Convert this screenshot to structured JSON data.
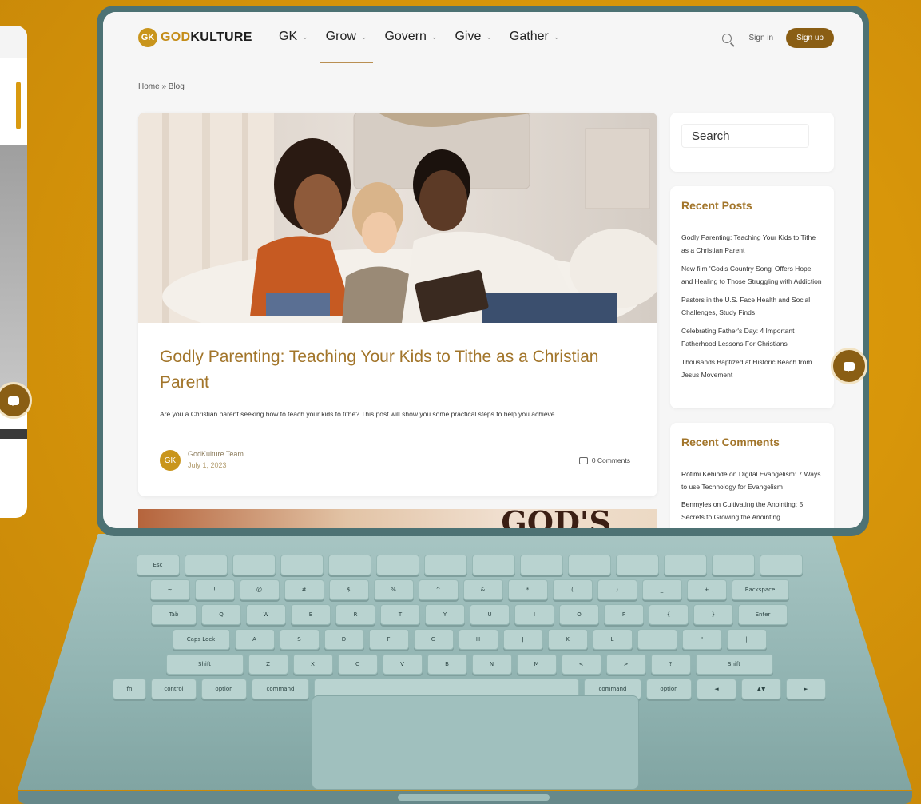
{
  "brand": {
    "logo_mark": "GK",
    "logo_prefix": "GOD",
    "logo_suffix": "KULTURE"
  },
  "nav": {
    "items": [
      {
        "label": "GK",
        "active": false
      },
      {
        "label": "Grow",
        "active": true
      },
      {
        "label": "Govern",
        "active": false
      },
      {
        "label": "Give",
        "active": false
      },
      {
        "label": "Gather",
        "active": false
      }
    ],
    "signin": "Sign in",
    "signup": "Sign up"
  },
  "breadcrumb": "Home » Blog",
  "post": {
    "title": "Godly Parenting: Teaching Your Kids to Tithe as a Christian Parent",
    "excerpt": "Are you a Christian parent seeking how to teach your kids to tithe? This post will show you some practical steps to help you achieve...",
    "author": "GodKulture Team",
    "date": "July 1, 2023",
    "comments": "0 Comments",
    "next_teaser": "GOD'S"
  },
  "sidebar": {
    "search_placeholder": "Search",
    "recent_posts_title": "Recent Posts",
    "recent_posts": [
      "Godly Parenting: Teaching Your Kids to Tithe as a Christian Parent",
      "New film 'God's Country Song' Offers Hope and Healing to Those Struggling with Addiction",
      "Pastors in the U.S. Face Health and Social Challenges, Study Finds",
      "Celebrating Father's Day: 4 Important Fatherhood Lessons For Christians",
      "Thousands Baptized at Historic Beach from Jesus Movement"
    ],
    "recent_comments_title": "Recent Comments",
    "recent_comments": [
      {
        "who": "Rotimi Kehinde",
        "on": "on",
        "post": "Digital Evangelism: 7 Ways to use Technology for Evangelism"
      },
      {
        "who": "Benmyles",
        "on": "on",
        "post": "Cultivating the Anointing: 5 Secrets to Growing the Anointing"
      }
    ]
  },
  "keyboard": {
    "rows": [
      [
        "Esc",
        "",
        "",
        "",
        "",
        "",
        "",
        "",
        "",
        "",
        "",
        "",
        "",
        ""
      ],
      [
        "~",
        "!",
        "@",
        "#",
        "$",
        "%",
        "^",
        "&",
        "*",
        "(",
        ")",
        "_",
        "+",
        "Backspace"
      ],
      [
        "Tab",
        "Q",
        "W",
        "E",
        "R",
        "T",
        "Y",
        "U",
        "I",
        "O",
        "P",
        "{",
        "}",
        "Enter"
      ],
      [
        "Caps Lock",
        "A",
        "S",
        "D",
        "F",
        "G",
        "H",
        "J",
        "K",
        "L",
        ":",
        "\"",
        "|"
      ],
      [
        "Shift",
        "Z",
        "X",
        "C",
        "V",
        "B",
        "N",
        "M",
        "<",
        ">",
        "?",
        "Shift"
      ],
      [
        "fn",
        "control",
        "option",
        "command",
        "",
        "command",
        "option",
        "◄",
        "▲▼",
        "►"
      ]
    ]
  },
  "colors": {
    "accent": "#a2752a",
    "button": "#8a5e14",
    "background": "#d8960a",
    "laptop": "#8fb2b0"
  }
}
